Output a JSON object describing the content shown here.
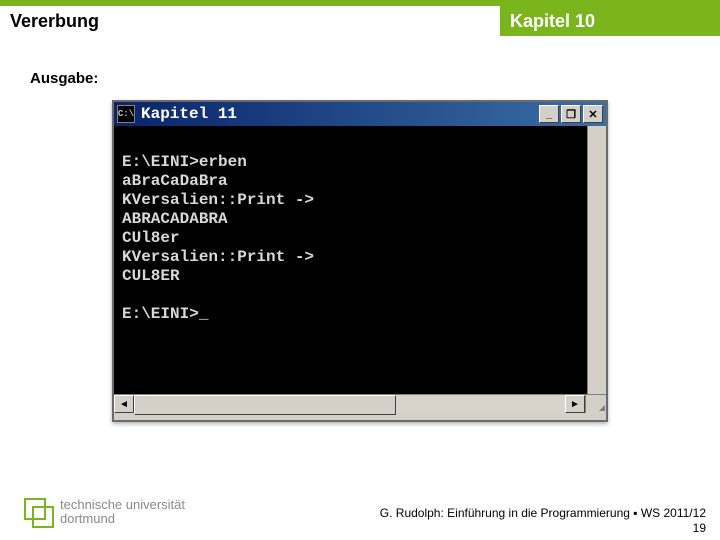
{
  "header": {
    "left": "Vererbung",
    "right": "Kapitel 10"
  },
  "label_ausgabe": "Ausgabe:",
  "window": {
    "icon_glyph": "C:\\",
    "title": "Kapitel 11",
    "buttons": {
      "min": "_",
      "max": "❐",
      "close": "✕"
    },
    "console_lines": [
      "E:\\EINI>erben",
      "aBraCaDaBra",
      "KVersalien::Print ->",
      "ABRACADABRA",
      "CUl8er",
      "KVersalien::Print ->",
      "CUL8ER",
      "",
      "E:\\EINI>_"
    ]
  },
  "footer": {
    "uni_line1": "technische universität",
    "uni_line2": "dortmund",
    "credit": "G. Rudolph: Einführung in die Programmierung ▪ WS 2011/12",
    "page": "19"
  }
}
